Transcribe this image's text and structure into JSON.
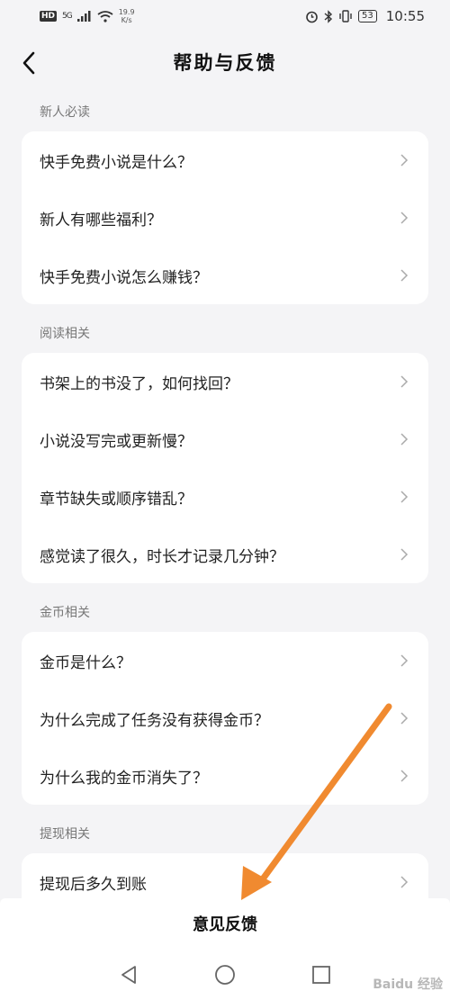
{
  "status_bar": {
    "hd": "HD",
    "network": "5G",
    "speed_value": "19.9",
    "speed_unit": "K/s",
    "battery": "53",
    "time": "10:55"
  },
  "header": {
    "title": "帮助与反馈"
  },
  "sections": [
    {
      "label": "新人必读",
      "items": [
        "快手免费小说是什么？",
        "新人有哪些福利？",
        "快手免费小说怎么赚钱？"
      ]
    },
    {
      "label": "阅读相关",
      "items": [
        "书架上的书没了，如何找回？",
        "小说没写完或更新慢？",
        "章节缺失或顺序错乱？",
        "感觉读了很久，时长才记录几分钟？"
      ]
    },
    {
      "label": "金币相关",
      "items": [
        "金币是什么？",
        "为什么完成了任务没有获得金币？",
        "为什么我的金币消失了？"
      ]
    },
    {
      "label": "提现相关",
      "items": [
        "提现后多久到账"
      ]
    }
  ],
  "footer": {
    "feedback_label": "意见反馈"
  },
  "watermark": "Baidu 经验",
  "colors": {
    "background": "#f4f4f6",
    "card": "#ffffff",
    "annotation_arrow": "#f08a30"
  }
}
